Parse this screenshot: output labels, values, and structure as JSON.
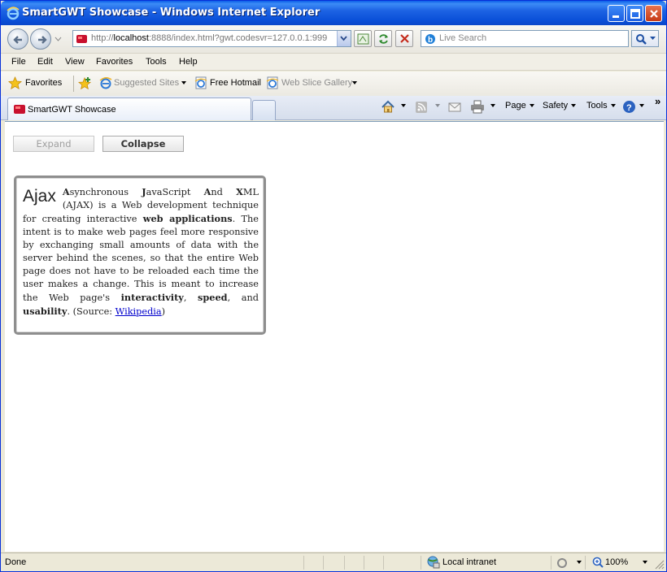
{
  "window": {
    "title": "SmartGWT Showcase - Windows Internet Explorer"
  },
  "address": {
    "prefix": "http://",
    "host": "localhost",
    "rest": ":8888/index.html?gwt.codesvr=127.0.0.1:999"
  },
  "search": {
    "placeholder": "Live Search"
  },
  "menu": [
    "File",
    "Edit",
    "View",
    "Favorites",
    "Tools",
    "Help"
  ],
  "favorites_bar": {
    "favorites_label": "Favorites",
    "suggested_sites": "Suggested Sites",
    "free_hotmail": "Free Hotmail",
    "web_slice_gallery": "Web Slice Gallery"
  },
  "tab": {
    "label": "SmartGWT Showcase"
  },
  "command_bar": {
    "page": "Page",
    "safety": "Safety",
    "tools": "Tools",
    "more": "»"
  },
  "buttons": {
    "expand": "Expand",
    "collapse": "Collapse"
  },
  "panel": {
    "title": "Ajax",
    "text": [
      {
        "t": "A",
        "b": true
      },
      {
        "t": "synchronous ",
        "b": false
      },
      {
        "t": "J",
        "b": true
      },
      {
        "t": "avaScript ",
        "b": false
      },
      {
        "t": "A",
        "b": true
      },
      {
        "t": "nd ",
        "b": false
      },
      {
        "t": "X",
        "b": true
      },
      {
        "t": "ML (AJAX) is a Web development technique for creating interactive ",
        "b": false
      },
      {
        "t": "web applications",
        "b": true
      },
      {
        "t": ". The intent is to make web pages feel more responsive by exchanging small amounts of data with the server behind the scenes, so that the entire Web page does not have to be reloaded each time the user makes a change. This is meant to increase the Web page's ",
        "b": false
      },
      {
        "t": "interactivity",
        "b": true
      },
      {
        "t": ", ",
        "b": false
      },
      {
        "t": "speed",
        "b": true
      },
      {
        "t": ", and ",
        "b": false
      },
      {
        "t": "usability",
        "b": true
      },
      {
        "t": ". (Source: ",
        "b": false
      }
    ],
    "link_text": "Wikipedia",
    "text_end": ")"
  },
  "status": {
    "text": "Done",
    "zone": "Local intranet",
    "zoom": "100%"
  },
  "colors": {
    "titlebar": "#0a5ee8",
    "link": "#0000cc",
    "panel_border": "#8e8e8e"
  }
}
